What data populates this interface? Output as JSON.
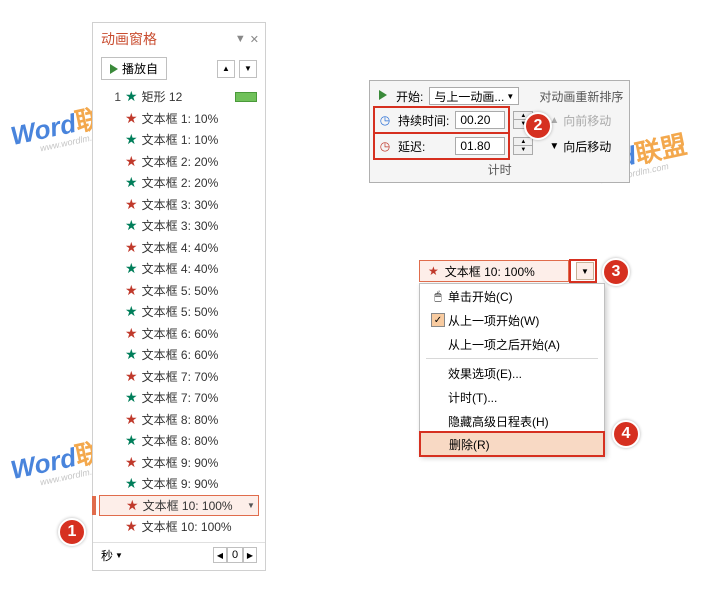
{
  "pane": {
    "title": "动画窗格",
    "play": "播放自",
    "seconds": "秒",
    "page": "0",
    "items": [
      {
        "num": "1",
        "star": "green",
        "label": "矩形 12",
        "bar": true
      },
      {
        "star": "red",
        "label": "文本框 1: 10%"
      },
      {
        "star": "green",
        "label": "文本框 1: 10%"
      },
      {
        "star": "red",
        "label": "文本框 2: 20%"
      },
      {
        "star": "green",
        "label": "文本框 2: 20%"
      },
      {
        "star": "red",
        "label": "文本框 3: 30%"
      },
      {
        "star": "green",
        "label": "文本框 3: 30%"
      },
      {
        "star": "red",
        "label": "文本框 4: 40%"
      },
      {
        "star": "green",
        "label": "文本框 4: 40%"
      },
      {
        "star": "red",
        "label": "文本框 5: 50%"
      },
      {
        "star": "green",
        "label": "文本框 5: 50%"
      },
      {
        "star": "red",
        "label": "文本框 6: 60%"
      },
      {
        "star": "green",
        "label": "文本框 6: 60%"
      },
      {
        "star": "red",
        "label": "文本框 7: 70%"
      },
      {
        "star": "green",
        "label": "文本框 7: 70%"
      },
      {
        "star": "red",
        "label": "文本框 8: 80%"
      },
      {
        "star": "green",
        "label": "文本框 8: 80%"
      },
      {
        "star": "red",
        "label": "文本框 9: 90%"
      },
      {
        "star": "green",
        "label": "文本框 9: 90%"
      },
      {
        "star": "red",
        "label": "文本框 10: 100%",
        "selected": true
      },
      {
        "star": "red",
        "label": "文本框 10: 100%"
      }
    ]
  },
  "timing": {
    "start_label": "开始:",
    "start_value": "与上一动画...",
    "reorder": "对动画重新排序",
    "duration_label": "持续时间:",
    "duration_value": "00.20",
    "delay_label": "延迟:",
    "delay_value": "01.80",
    "move_prev": "向前移动",
    "move_next": "向后移动",
    "footer": "计时"
  },
  "ctx": {
    "header_label": "文本框 10: 100%",
    "items": {
      "click": "单击开始(C)",
      "with_prev": "从上一项开始(W)",
      "after_prev": "从上一项之后开始(A)",
      "effect": "效果选项(E)...",
      "timing": "计时(T)...",
      "hide": "隐藏高级日程表(H)",
      "remove": "删除(R)"
    }
  },
  "wm": {
    "brand1": "Word",
    "brand2": "联盟",
    "url": "www.wordlm.com"
  }
}
